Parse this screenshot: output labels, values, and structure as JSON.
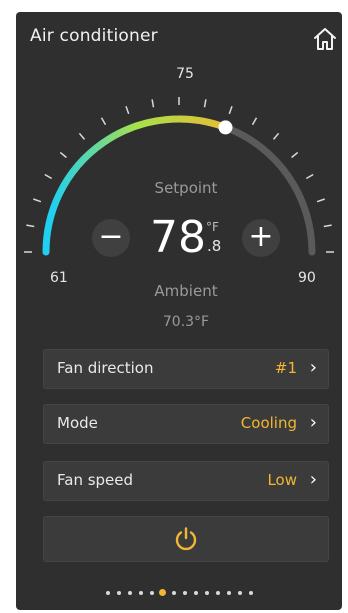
{
  "header": {
    "title": "Air conditioner",
    "home_icon": "home-icon"
  },
  "gauge": {
    "min_label": "61",
    "max_label": "90",
    "mid_label": "75",
    "min": 61,
    "max": 90,
    "value": 78.8,
    "colors": {
      "cold": "#1fd0f0",
      "mid": "#a8e04a",
      "warm": "#f2b632",
      "track": "#5a5a5a",
      "tick": "#d9d9d9"
    }
  },
  "setpoint": {
    "label": "Setpoint",
    "value": "78",
    "unit": "°F",
    "decimal": ".8",
    "minus": "−",
    "plus": "+"
  },
  "ambient": {
    "label": "Ambient",
    "value": "70.3°F"
  },
  "rows": [
    {
      "label": "Fan direction",
      "value": "#1",
      "chevron": "›"
    },
    {
      "label": "Mode",
      "value": "Cooling",
      "chevron": "›"
    },
    {
      "label": "Fan speed",
      "value": "Low",
      "chevron": "›"
    }
  ],
  "power": {
    "icon": "power-icon",
    "color": "#f2b632"
  },
  "pagination": {
    "count": 14,
    "active_index": 5
  }
}
